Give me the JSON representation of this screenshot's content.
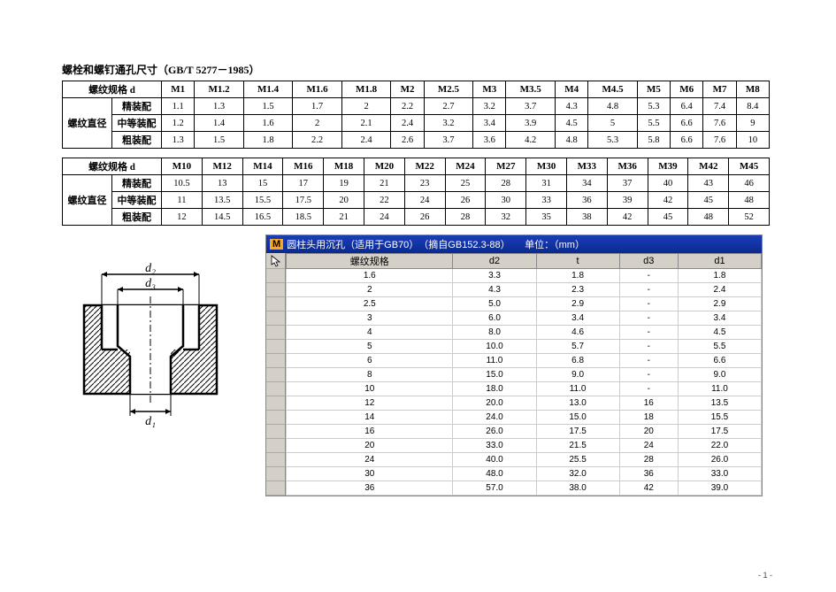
{
  "title": "螺栓和螺钉通孔尺寸（GB/T 5277－1985）",
  "table1": {
    "hdr_label": "螺纹规格 d",
    "rowgroup_label": "螺纹直径",
    "row_labels": [
      "精装配",
      "中等装配",
      "粗装配"
    ],
    "cols": [
      "M1",
      "M1.2",
      "M1.4",
      "M1.6",
      "M1.8",
      "M2",
      "M2.5",
      "M3",
      "M3.5",
      "M4",
      "M4.5",
      "M5",
      "M6",
      "M7",
      "M8"
    ],
    "rows": [
      [
        "1.1",
        "1.3",
        "1.5",
        "1.7",
        "2",
        "2.2",
        "2.7",
        "3.2",
        "3.7",
        "4.3",
        "4.8",
        "5.3",
        "6.4",
        "7.4",
        "8.4"
      ],
      [
        "1.2",
        "1.4",
        "1.6",
        "2",
        "2.1",
        "2.4",
        "3.2",
        "3.4",
        "3.9",
        "4.5",
        "5",
        "5.5",
        "6.6",
        "7.6",
        "9"
      ],
      [
        "1.3",
        "1.5",
        "1.8",
        "2.2",
        "2.4",
        "2.6",
        "3.7",
        "3.6",
        "4.2",
        "4.8",
        "5.3",
        "5.8",
        "6.6",
        "7.6",
        "10"
      ]
    ]
  },
  "table2": {
    "hdr_label": "螺纹规格 d",
    "rowgroup_label": "螺纹直径",
    "row_labels": [
      "精装配",
      "中等装配",
      "粗装配"
    ],
    "cols": [
      "M10",
      "M12",
      "M14",
      "M16",
      "M18",
      "M20",
      "M22",
      "M24",
      "M27",
      "M30",
      "M33",
      "M36",
      "M39",
      "M42",
      "M45"
    ],
    "rows": [
      [
        "10.5",
        "13",
        "15",
        "17",
        "19",
        "21",
        "23",
        "25",
        "28",
        "31",
        "34",
        "37",
        "40",
        "43",
        "46"
      ],
      [
        "11",
        "13.5",
        "15.5",
        "17.5",
        "20",
        "22",
        "24",
        "26",
        "30",
        "33",
        "36",
        "39",
        "42",
        "45",
        "48"
      ],
      [
        "12",
        "14.5",
        "16.5",
        "18.5",
        "21",
        "24",
        "26",
        "28",
        "32",
        "35",
        "38",
        "42",
        "45",
        "48",
        "52"
      ]
    ]
  },
  "diagram_labels": {
    "d1": "d₁",
    "d2": "d₂",
    "d3": "d₃"
  },
  "spreadsheet": {
    "title_prefix": "M",
    "title_text": "圆柱头用沉孔（适用于GB70）　（摘自GB152.3-88）　　单位：（mm）",
    "headers": [
      "螺纹规格",
      "d2",
      "t",
      "d3",
      "d1"
    ],
    "rows": [
      [
        "1.6",
        "3.3",
        "1.8",
        "-",
        "1.8"
      ],
      [
        "2",
        "4.3",
        "2.3",
        "-",
        "2.4"
      ],
      [
        "2.5",
        "5.0",
        "2.9",
        "-",
        "2.9"
      ],
      [
        "3",
        "6.0",
        "3.4",
        "-",
        "3.4"
      ],
      [
        "4",
        "8.0",
        "4.6",
        "-",
        "4.5"
      ],
      [
        "5",
        "10.0",
        "5.7",
        "-",
        "5.5"
      ],
      [
        "6",
        "11.0",
        "6.8",
        "-",
        "6.6"
      ],
      [
        "8",
        "15.0",
        "9.0",
        "-",
        "9.0"
      ],
      [
        "10",
        "18.0",
        "11.0",
        "-",
        "11.0"
      ],
      [
        "12",
        "20.0",
        "13.0",
        "16",
        "13.5"
      ],
      [
        "14",
        "24.0",
        "15.0",
        "18",
        "15.5"
      ],
      [
        "16",
        "26.0",
        "17.5",
        "20",
        "17.5"
      ],
      [
        "20",
        "33.0",
        "21.5",
        "24",
        "22.0"
      ],
      [
        "24",
        "40.0",
        "25.5",
        "28",
        "26.0"
      ],
      [
        "30",
        "48.0",
        "32.0",
        "36",
        "33.0"
      ],
      [
        "36",
        "57.0",
        "38.0",
        "42",
        "39.0"
      ]
    ]
  },
  "pagenum": "- 1 -"
}
